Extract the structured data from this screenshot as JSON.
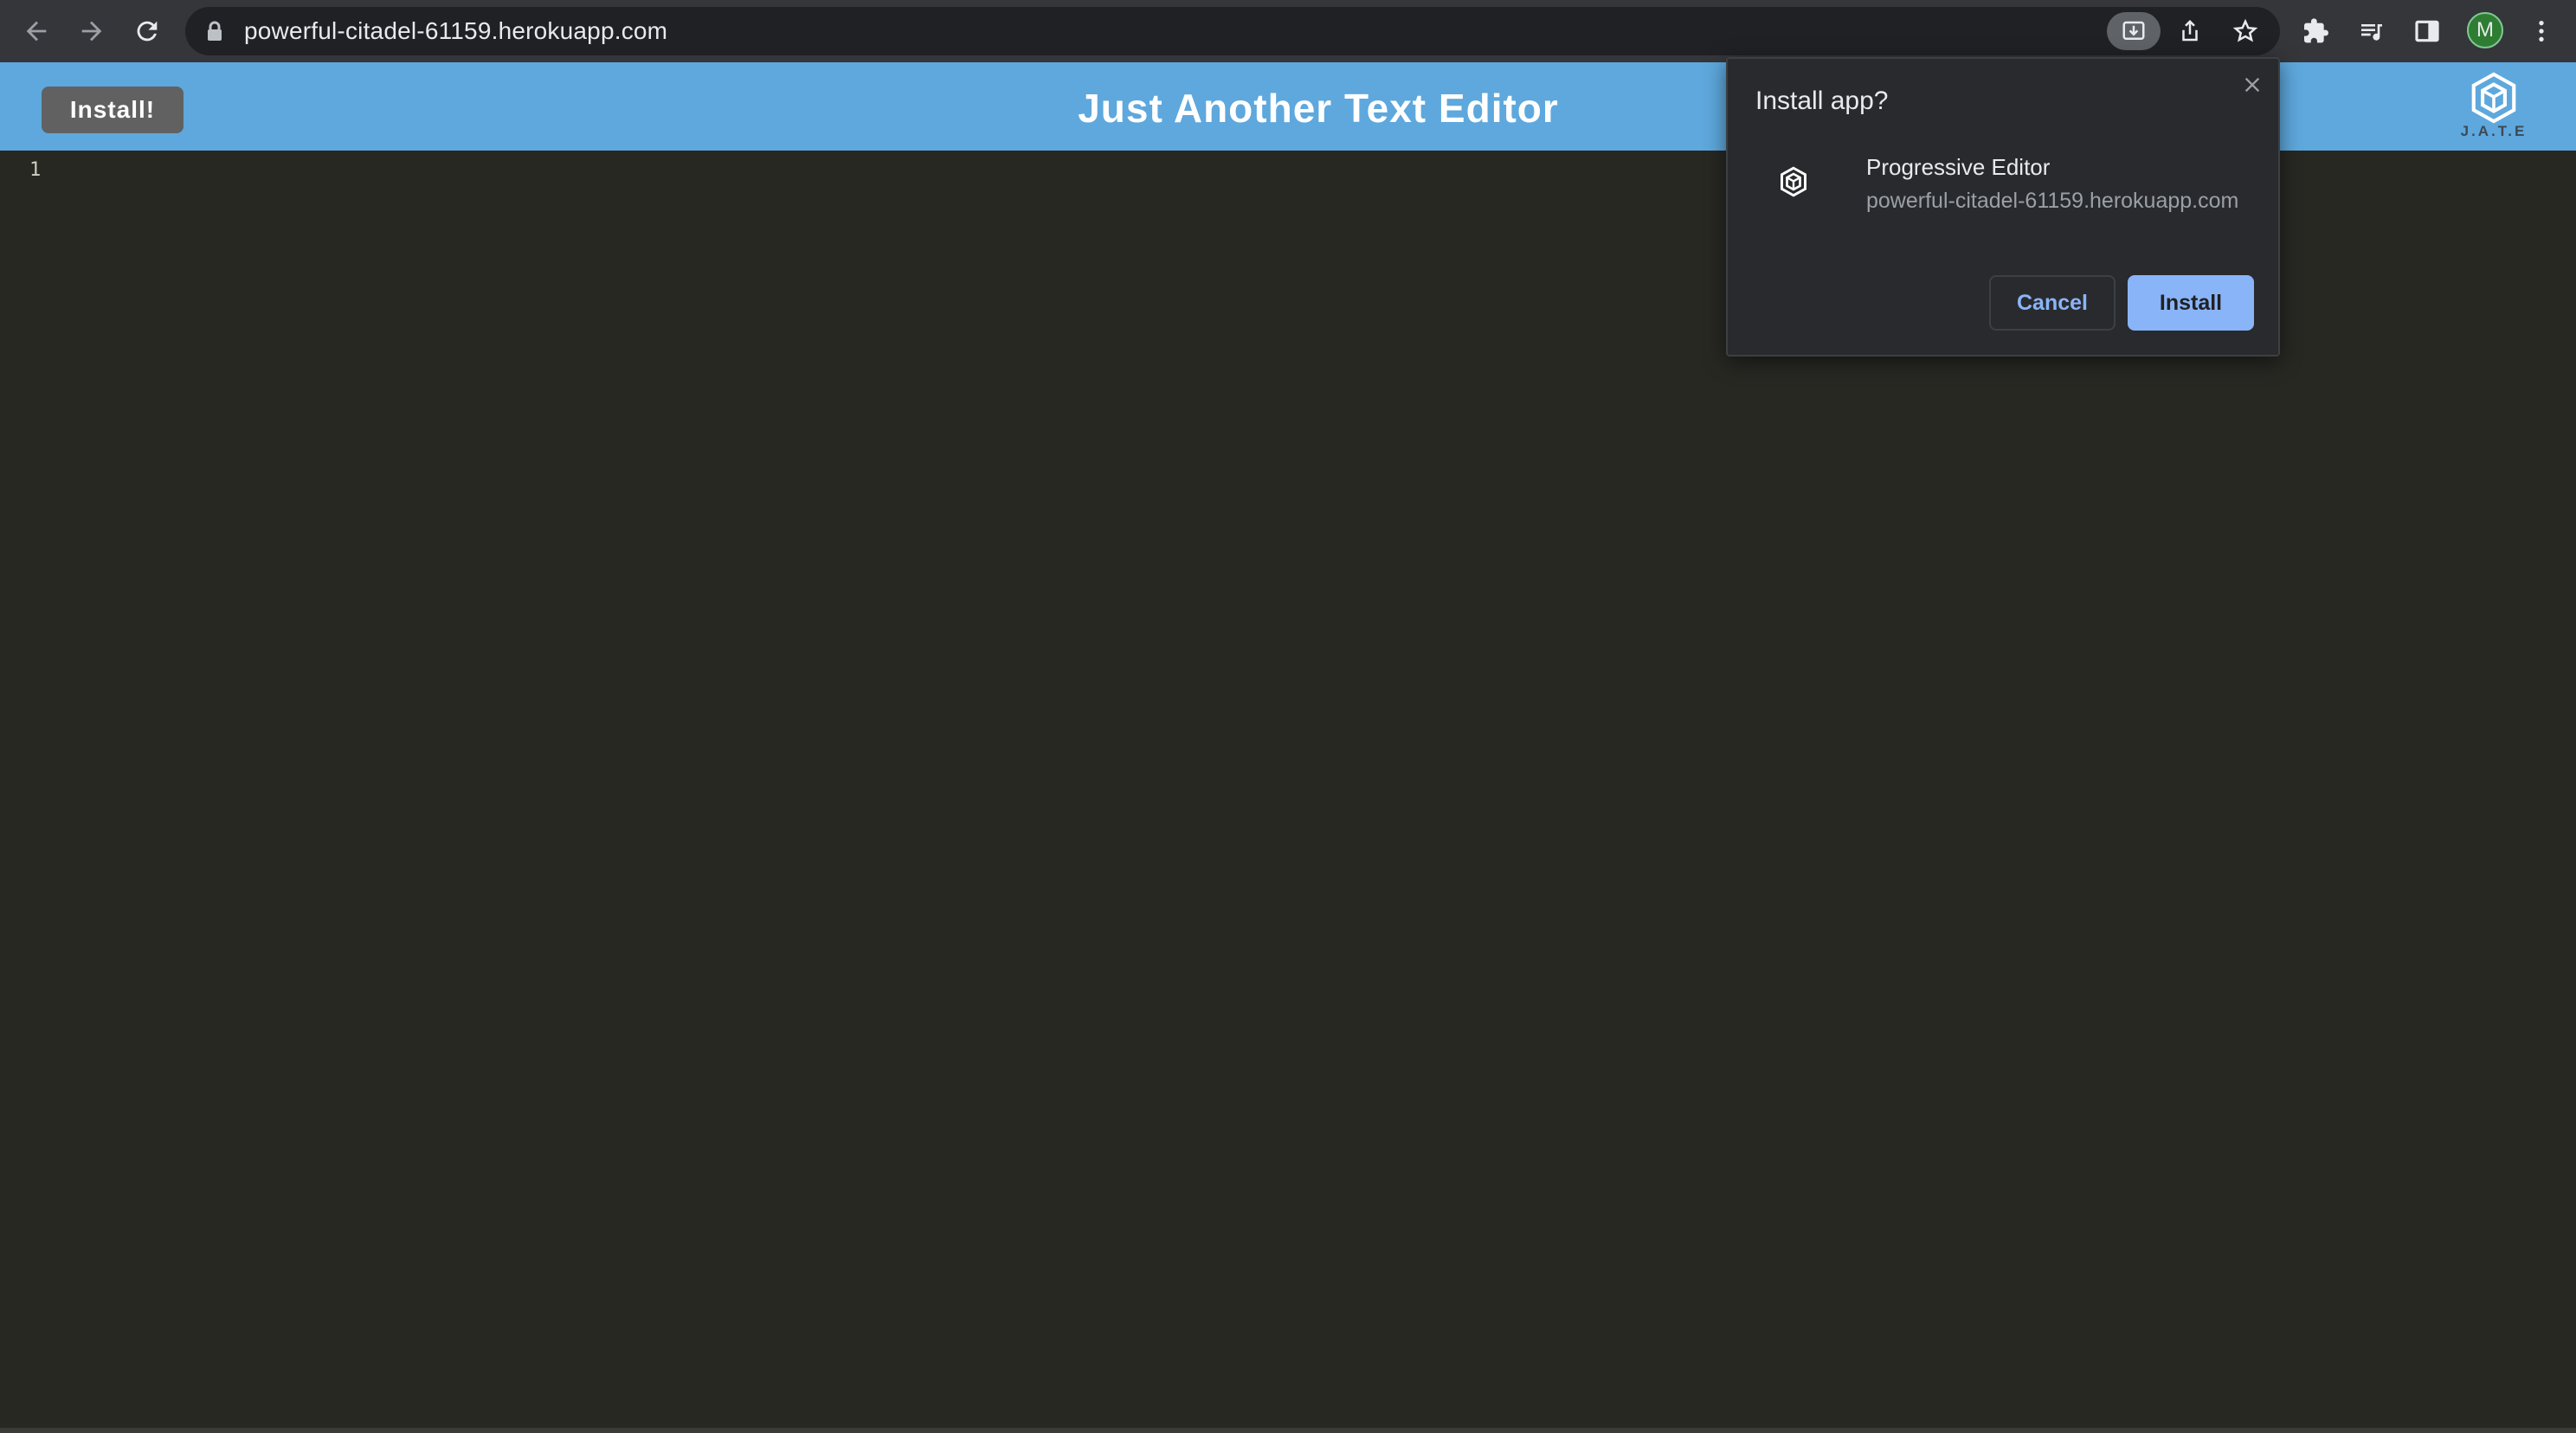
{
  "browser": {
    "url": "powerful-citadel-61159.herokuapp.com",
    "profile_initial": "M",
    "icons": {
      "back": "back-arrow-icon",
      "forward": "forward-arrow-icon",
      "reload": "reload-icon",
      "lock": "lock-icon",
      "install": "install-app-icon",
      "share": "share-icon",
      "bookmark": "star-icon",
      "extensions": "puzzle-icon",
      "media": "media-control-icon",
      "side_panel": "side-panel-icon",
      "menu": "kebab-menu-icon"
    }
  },
  "app": {
    "install_button_label": "Install!",
    "title": "Just Another Text Editor",
    "logo_text": "J.A.T.E",
    "header_color": "#5ea8dd"
  },
  "editor": {
    "line_numbers": [
      "1"
    ],
    "background": "#272822"
  },
  "install_dialog": {
    "title": "Install app?",
    "app_name": "Progressive Editor",
    "app_origin": "powerful-citadel-61159.herokuapp.com",
    "cancel_label": "Cancel",
    "install_label": "Install",
    "accent_color": "#8ab4f8"
  }
}
